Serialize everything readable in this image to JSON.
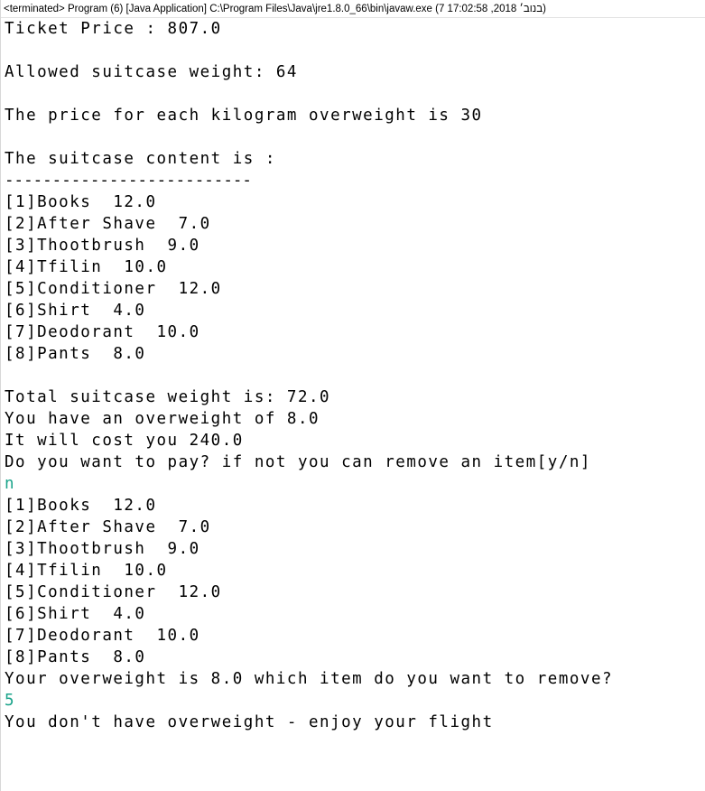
{
  "status_bar": {
    "text": "<terminated> Program (6) [Java Application] C:\\Program Files\\Java\\jre1.8.0_66\\bin\\javaw.exe (7 17:02:58 ,2018 בנוב׳)"
  },
  "console": {
    "lines": [
      {
        "text": "Ticket Price : 807.0",
        "kind": "output"
      },
      {
        "text": "",
        "kind": "output"
      },
      {
        "text": "Allowed suitcase weight: 64",
        "kind": "output"
      },
      {
        "text": "",
        "kind": "output"
      },
      {
        "text": "The price for each kilogram overweight is 30",
        "kind": "output"
      },
      {
        "text": "",
        "kind": "output"
      },
      {
        "text": "The suitcase content is :",
        "kind": "output"
      },
      {
        "text": "--------------------------",
        "kind": "divider"
      },
      {
        "text": "[1]Books  12.0",
        "kind": "output"
      },
      {
        "text": "[2]After Shave  7.0",
        "kind": "output"
      },
      {
        "text": "[3]Thootbrush  9.0",
        "kind": "output"
      },
      {
        "text": "[4]Tfilin  10.0",
        "kind": "output"
      },
      {
        "text": "[5]Conditioner  12.0",
        "kind": "output"
      },
      {
        "text": "[6]Shirt  4.0",
        "kind": "output"
      },
      {
        "text": "[7]Deodorant  10.0",
        "kind": "output"
      },
      {
        "text": "[8]Pants  8.0",
        "kind": "output"
      },
      {
        "text": "",
        "kind": "output"
      },
      {
        "text": "Total suitcase weight is: 72.0",
        "kind": "output"
      },
      {
        "text": "You have an overweight of 8.0",
        "kind": "output"
      },
      {
        "text": "It will cost you 240.0",
        "kind": "output"
      },
      {
        "text": "Do you want to pay? if not you can remove an item[y/n]",
        "kind": "output"
      },
      {
        "text": "n",
        "kind": "input"
      },
      {
        "text": "[1]Books  12.0",
        "kind": "output"
      },
      {
        "text": "[2]After Shave  7.0",
        "kind": "output"
      },
      {
        "text": "[3]Thootbrush  9.0",
        "kind": "output"
      },
      {
        "text": "[4]Tfilin  10.0",
        "kind": "output"
      },
      {
        "text": "[5]Conditioner  12.0",
        "kind": "output"
      },
      {
        "text": "[6]Shirt  4.0",
        "kind": "output"
      },
      {
        "text": "[7]Deodorant  10.0",
        "kind": "output"
      },
      {
        "text": "[8]Pants  8.0",
        "kind": "output"
      },
      {
        "text": "Your overweight is 8.0 which item do you want to remove?",
        "kind": "output"
      },
      {
        "text": "5",
        "kind": "input"
      },
      {
        "text": "You don't have overweight - enjoy your flight",
        "kind": "output",
        "caret": true
      }
    ]
  },
  "colors": {
    "background": "#ffffff",
    "output_text": "#000000",
    "user_input_text": "#1aa38a"
  }
}
